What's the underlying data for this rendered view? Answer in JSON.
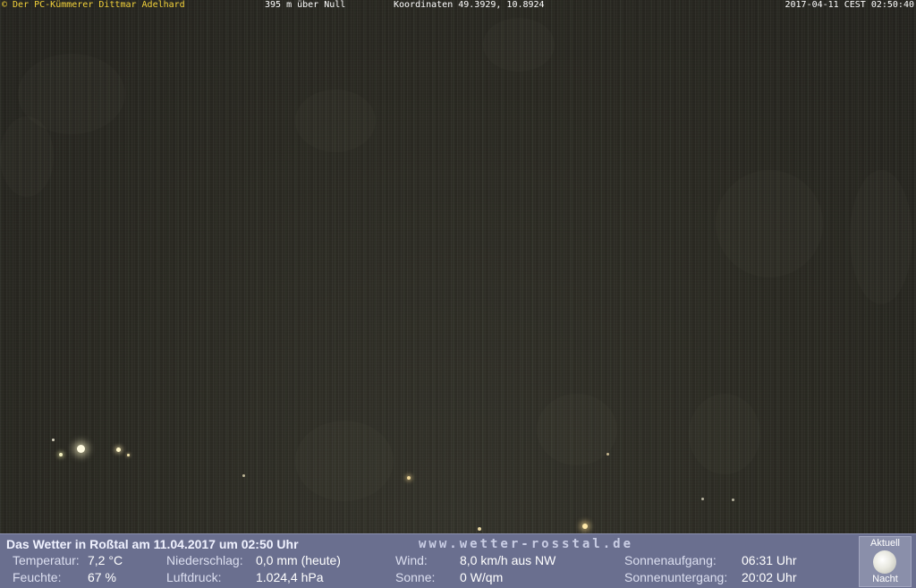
{
  "overlay": {
    "owner": "© Der PC-Kümmerer Dittmar Adelhard",
    "altitude": "395 m über Null",
    "coordinates": "Koordinaten 49.3929, 10.8924",
    "timestamp": "2017-04-11 CEST 02:50:40"
  },
  "footer": {
    "title": "Das Wetter in Roßtal am 11.04.2017 um 02:50 Uhr",
    "url": "www.wetter-rosstal.de",
    "temperature_label": "Temperatur:",
    "temperature_value": "7,2 °C",
    "humidity_label": "Feuchte:",
    "humidity_value": "67 %",
    "precip_label": "Niederschlag:",
    "precip_value": "0,0 mm (heute)",
    "pressure_label": "Luftdruck:",
    "pressure_value": "1.024,4 hPa",
    "wind_label": "Wind:",
    "wind_value": "8,0 km/h aus NW",
    "sun_label": "Sonne:",
    "sun_value": "0 W/qm",
    "sunrise_label": "Sonnenaufgang:",
    "sunrise_value": "06:31 Uhr",
    "sunset_label": "Sonnenuntergang:",
    "sunset_value": "20:02 Uhr",
    "moon_top_label": "Aktuell",
    "moon_bottom_label": "Nacht"
  }
}
